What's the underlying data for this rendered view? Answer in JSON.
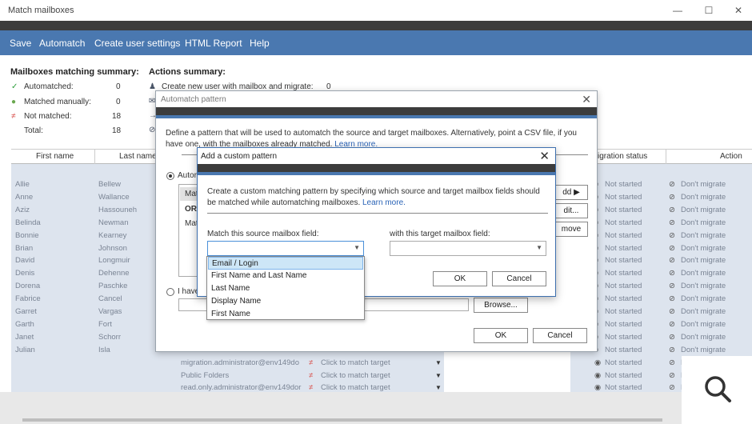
{
  "window": {
    "title": "Match mailboxes"
  },
  "menu": [
    "Save",
    "Automatch",
    "Create user settings",
    "HTML Report",
    "Help"
  ],
  "summary": {
    "title": "Mailboxes matching summary:",
    "rows": [
      {
        "label": "Automatched:",
        "value": "0"
      },
      {
        "label": "Matched manually:",
        "value": "0"
      },
      {
        "label": "Not matched:",
        "value": "18"
      },
      {
        "label": "Total:",
        "value": "18"
      }
    ]
  },
  "actions": {
    "title": "Actions summary:",
    "first": {
      "label": "Create new user with mailbox and migrate:",
      "value": "0"
    }
  },
  "table": {
    "headers": {
      "first_name": "First name",
      "last_name": "Last name",
      "migration_status": "igration status",
      "action": "Action"
    },
    "rows": [
      {
        "first": "Allie",
        "last": "Bellew"
      },
      {
        "first": "Anne",
        "last": "Wallance"
      },
      {
        "first": "Aziz",
        "last": "Hassouneh"
      },
      {
        "first": "Belinda",
        "last": "Newman"
      },
      {
        "first": "Bonnie",
        "last": "Kearney"
      },
      {
        "first": "Brian",
        "last": "Johnson"
      },
      {
        "first": "David",
        "last": "Longmuir"
      },
      {
        "first": "Denis",
        "last": "Dehenne"
      },
      {
        "first": "Dorena",
        "last": "Paschke"
      },
      {
        "first": "Fabrice",
        "last": "Cancel"
      },
      {
        "first": "Garret",
        "last": "Vargas"
      },
      {
        "first": "Garth",
        "last": "Fort"
      },
      {
        "first": "Janet",
        "last": "Schorr"
      },
      {
        "first": "Julian",
        "last": "Isla"
      }
    ],
    "status_text": "Not started",
    "action_text": "Don't migrate",
    "extra_rows": [
      {
        "mailbox": "migration.administrator@env149do",
        "target": "Click to match target"
      },
      {
        "mailbox": "Public Folders",
        "target": "Click to match target"
      },
      {
        "mailbox": "read.only.administrator@env149dor",
        "target": "Click to match target"
      }
    ]
  },
  "automatch_dialog": {
    "title": "Automatch pattern",
    "description": "Define a pattern that will be used to automatch the source and target mailboxes. Alternatively, point a CSV file, if you have one, with the mailboxes already matched.",
    "learn_more": "Learn more.",
    "radio1": "Autor",
    "radio2": "I have",
    "list_line1": "Matc",
    "list_or": "OR",
    "list_line3": "Matc",
    "add_button": "dd",
    "edit_button": "dit...",
    "remove_button": "move",
    "browse_button": "Browse...",
    "ok": "OK",
    "cancel": "Cancel"
  },
  "custom_dialog": {
    "title": "Add a custom pattern",
    "description": "Create a custom matching pattern by specifying which source and target mailbox fields should be matched while automatching mailboxes.",
    "learn_more": "Learn more.",
    "source_label": "Match this source mailbox field:",
    "target_label": "with this target mailbox field:",
    "ok": "OK",
    "cancel": "Cancel",
    "options": [
      "Email / Login",
      "First Name and Last Name",
      "Last Name",
      "Display Name",
      "First Name"
    ],
    "selected_index": 0
  },
  "colors": {
    "accent": "#4a78b0",
    "dark_band": "#3c3c3c",
    "grid_bg": "#dde4ee",
    "link": "#2a63b6"
  }
}
